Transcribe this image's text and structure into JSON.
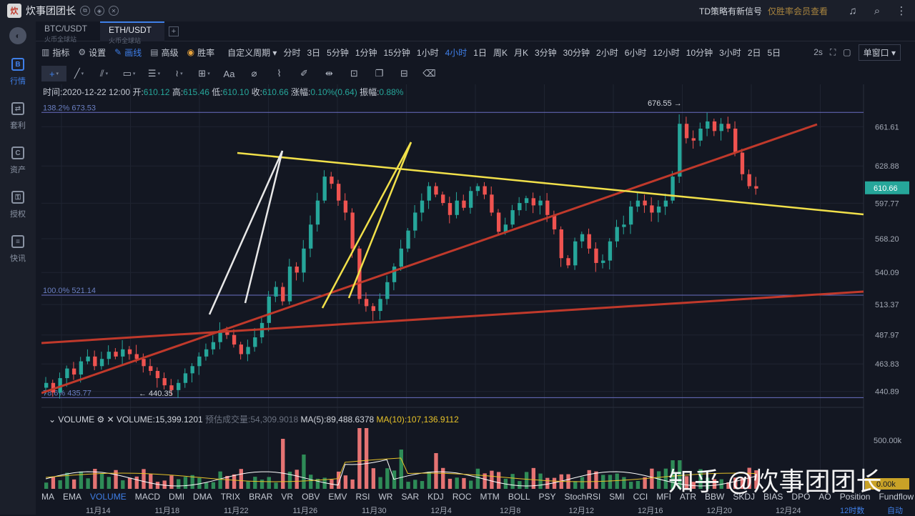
{
  "titlebar": {
    "title": "炊事团团长",
    "td_signal": "TD策略有新信号",
    "vip": "仅胜率会员查看"
  },
  "leftnav": [
    {
      "label": "行情",
      "icon": "B"
    },
    {
      "label": "套利",
      "icon": "⇄"
    },
    {
      "label": "资产",
      "icon": "C"
    },
    {
      "label": "授权",
      "icon": "⚿"
    },
    {
      "label": "快讯",
      "icon": "≡"
    }
  ],
  "pairs": [
    {
      "pair": "BTC/USDT",
      "exchange": "火币全球站"
    },
    {
      "pair": "ETH/USDT",
      "exchange": "火币全球站"
    }
  ],
  "toolbar": {
    "indicator": "指标",
    "settings": "设置",
    "draw": "画线",
    "advanced": "高级",
    "winrate": "胜率",
    "custom_period": "自定义周期",
    "periods": [
      "分时",
      "3日",
      "5分钟",
      "1分钟",
      "15分钟",
      "1小时",
      "4小时",
      "1日",
      "周K",
      "月K",
      "3分钟",
      "30分钟",
      "2小时",
      "6小时",
      "12小时",
      "10分钟",
      "3小时",
      "2日",
      "5日"
    ],
    "active_period": "4小时",
    "refresh": "2s",
    "single_window": "单窗口"
  },
  "info": {
    "time_label": "时间:",
    "time": "2020-12-22 12:00",
    "open_label": "开:",
    "open": "610.12",
    "high_label": "高:",
    "high": "615.46",
    "low_label": "低:",
    "low": "610.10",
    "close_label": "收:",
    "close": "610.66",
    "chg_label": "涨幅:",
    "chg": "0.10%(0.64)",
    "amp_label": "振幅:",
    "amp": "0.88%"
  },
  "fib": {
    "top": "138.2% 673.53",
    "mid": "100.0% 521.14",
    "bot": "78.6% 435.77"
  },
  "annotations": {
    "high": "676.55 →",
    "low": "← 440.35"
  },
  "price_axis": [
    "661.61",
    "628.88",
    "597.77",
    "568.20",
    "540.09",
    "513.37",
    "487.97",
    "463.83",
    "440.89"
  ],
  "current_price": "610.66",
  "volume": {
    "name": "VOLUME",
    "value_label": "VOLUME:15,399.1201",
    "predict": "预估成交量:54,309.9018",
    "ma5": "MA(5):89,488.6378",
    "ma10": "MA(10):107,136.9112",
    "axis_top": "500.00k",
    "axis_tag": "0.00k"
  },
  "indicators": [
    "MA",
    "EMA",
    "VOLUME",
    "MACD",
    "DMI",
    "DMA",
    "TRIX",
    "BRAR",
    "VR",
    "OBV",
    "EMV",
    "RSI",
    "WR",
    "SAR",
    "KDJ",
    "ROC",
    "MTM",
    "BOLL",
    "PSY",
    "StochRSI",
    "SMI",
    "CCI",
    "MFI",
    "ATR",
    "BBW",
    "SKDJ",
    "BIAS",
    "DPO",
    "AO",
    "Position",
    "Fundflow"
  ],
  "active_indicator": "VOLUME",
  "dates": [
    "11月14",
    "11月18",
    "11月22",
    "11月26",
    "11月30",
    "12月4",
    "12月8",
    "12月12",
    "12月16",
    "12月20",
    "12月24",
    "12时数",
    "自动"
  ],
  "watermark": "知乎 @炊事团团长",
  "colors": {
    "up": "#26a69a",
    "down": "#ef5350",
    "accent": "#3f7fe8",
    "trend_red": "#c0392b",
    "trend_yellow": "#f1e04a",
    "trend_white": "#e8e8e8"
  },
  "chart_data": {
    "type": "candlestick",
    "interval": "4小时",
    "closes": [
      448,
      440,
      452,
      460,
      455,
      466,
      470,
      462,
      468,
      474,
      470,
      476,
      472,
      468,
      462,
      458,
      452,
      446,
      442,
      448,
      456,
      462,
      470,
      476,
      482,
      492,
      488,
      480,
      472,
      478,
      486,
      498,
      520,
      528,
      516,
      545,
      540,
      560,
      580,
      600,
      620,
      614,
      600,
      590,
      560,
      518,
      512,
      508,
      518,
      532,
      545,
      560,
      575,
      590,
      600,
      612,
      605,
      598,
      588,
      600,
      594,
      608,
      612,
      605,
      590,
      574,
      580,
      592,
      598,
      602,
      596,
      600,
      588,
      576,
      552,
      546,
      566,
      572,
      560,
      548,
      550,
      566,
      578,
      580,
      595,
      600,
      596,
      590,
      595,
      600,
      620,
      664,
      652,
      650,
      660,
      666,
      658,
      664,
      660,
      640,
      622,
      612,
      610
    ],
    "ylim": [
      430,
      685
    ]
  }
}
